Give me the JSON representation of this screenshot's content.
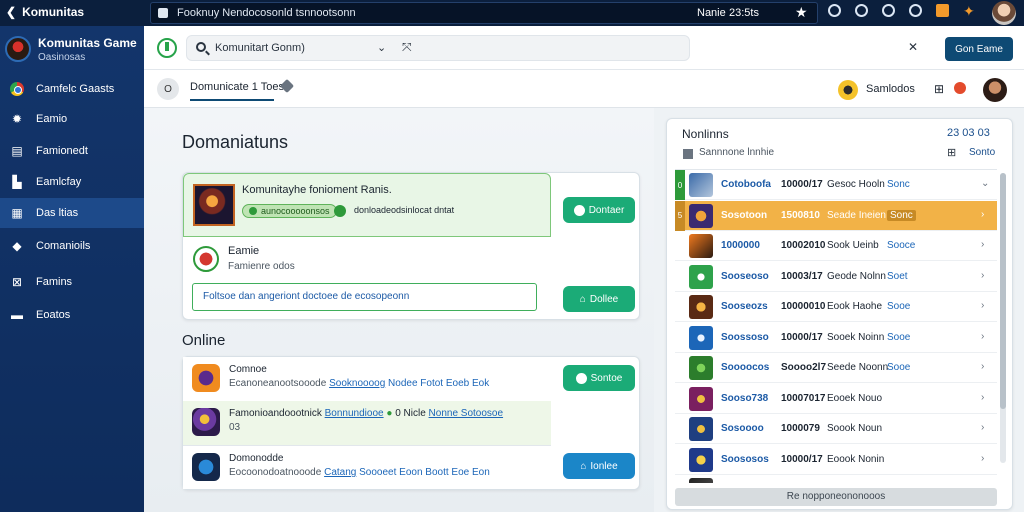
{
  "topbar": {
    "app_title": "Komunitas",
    "url_text": "Fooknuy Nendocosonld tsnnootsonn",
    "clock": "Nanie",
    "time": "23:5ts"
  },
  "sidebar": {
    "title": "Komunitas Game",
    "subtitle": "Oasinosas",
    "items": [
      {
        "label": "Camfelc Gaasts",
        "icon": "chrome-icon"
      },
      {
        "label": "Eamio",
        "icon": "gear-icon"
      },
      {
        "label": "Famionedt",
        "icon": "document-icon"
      },
      {
        "label": "Eamlcfay",
        "icon": "chart-icon"
      },
      {
        "label": "Das ltias",
        "icon": "list-icon"
      },
      {
        "label": "Comanioils",
        "icon": "chat-icon"
      },
      {
        "label": "Famins",
        "icon": "box-icon"
      },
      {
        "label": "Eoatos",
        "icon": "stack-icon"
      }
    ]
  },
  "header": {
    "search_text": "Komunitart Gonm)",
    "action_button": "Gon Eame"
  },
  "subheader": {
    "tab_circle": "O",
    "active_tab": "Domunicate 1 Toes",
    "user_name": "Samlodos"
  },
  "main": {
    "section_title": "Domaniatuns",
    "featured": {
      "name": "Komunitayhe fonioment Ranis.",
      "badge": "aunocooooonsos",
      "desc": "donloadeodsinlocat dntat",
      "row2_name": "Eamie",
      "row2_sub": "Famienre odos",
      "message": "Foltsoe dan angeriont doctoee de ecosopeonn",
      "button1": "Dontaer",
      "button2": "Dollee"
    },
    "online_title": "Online",
    "online": [
      {
        "name": "Comnoe",
        "meta_prefix": "Ecanoneanootsooode",
        "link": "Sooknoooog",
        "meta_suffix": "Nodee Fotot Eoeb Eok"
      },
      {
        "name": "Famonioandoootnick",
        "meta_prefix": "",
        "link": "Bonnundiooe",
        "meta_suffix": "0 Nicle",
        "link2": "Nonne Sotoosoe",
        "extra": "03"
      },
      {
        "name": "Domonodde",
        "meta_prefix": "Eocoonodoatnooode",
        "link": "Catang",
        "meta_suffix": "Soooeet Eoon Boott Eoe Eon"
      }
    ],
    "online_buttons": [
      "Sontoe",
      "Ionlee"
    ]
  },
  "panel": {
    "title": "Nonlinns",
    "stats": "23 03 03",
    "sub": "Sannnone lnnhie",
    "grid_label": "Sonto",
    "rows": [
      {
        "idx": "0",
        "c1": "Cotoboofa",
        "c2": "10000/17",
        "c3": "Gesoc Hooln",
        "c4": "Sonc"
      },
      {
        "idx": "5",
        "c1": "Sosotoon",
        "c2": "1500810",
        "c3": "Seade Ineien",
        "c4": "Sonc"
      },
      {
        "idx": "",
        "c1": "1000000",
        "c2": "10002010",
        "c3": "Sook Ueinb",
        "c4": "Sooce"
      },
      {
        "idx": "",
        "c1": "Sooseoso",
        "c2": "10003/17",
        "c3": "Geode Nolnn",
        "c4": "Soet"
      },
      {
        "idx": "",
        "c1": "Sooseozs",
        "c2": "10000010",
        "c3": "Eook Haohe",
        "c4": "Sooe"
      },
      {
        "idx": "",
        "c1": "Soossoso",
        "c2": "10000/17",
        "c3": "Sooek Noinn",
        "c4": "Sooe"
      },
      {
        "idx": "",
        "c1": "Soooocos",
        "c2": "Soooo2l7",
        "c3": "Seede Noonn",
        "c4": "Sooe"
      },
      {
        "idx": "",
        "c1": "Sooso738",
        "c2": "10007017",
        "c3": "Eooek Nouo",
        "c4": ""
      },
      {
        "idx": "",
        "c1": "Sosoooo",
        "c2": "1000079",
        "c3": "Soook Noun",
        "c4": ""
      },
      {
        "idx": "",
        "c1": "Soososos",
        "c2": "10000/17",
        "c3": "Eoook Nonin",
        "c4": ""
      },
      {
        "idx": "",
        "c1": "",
        "c2": "",
        "c3": "",
        "c4": ""
      }
    ],
    "footer": "Re nopponeononooos"
  }
}
